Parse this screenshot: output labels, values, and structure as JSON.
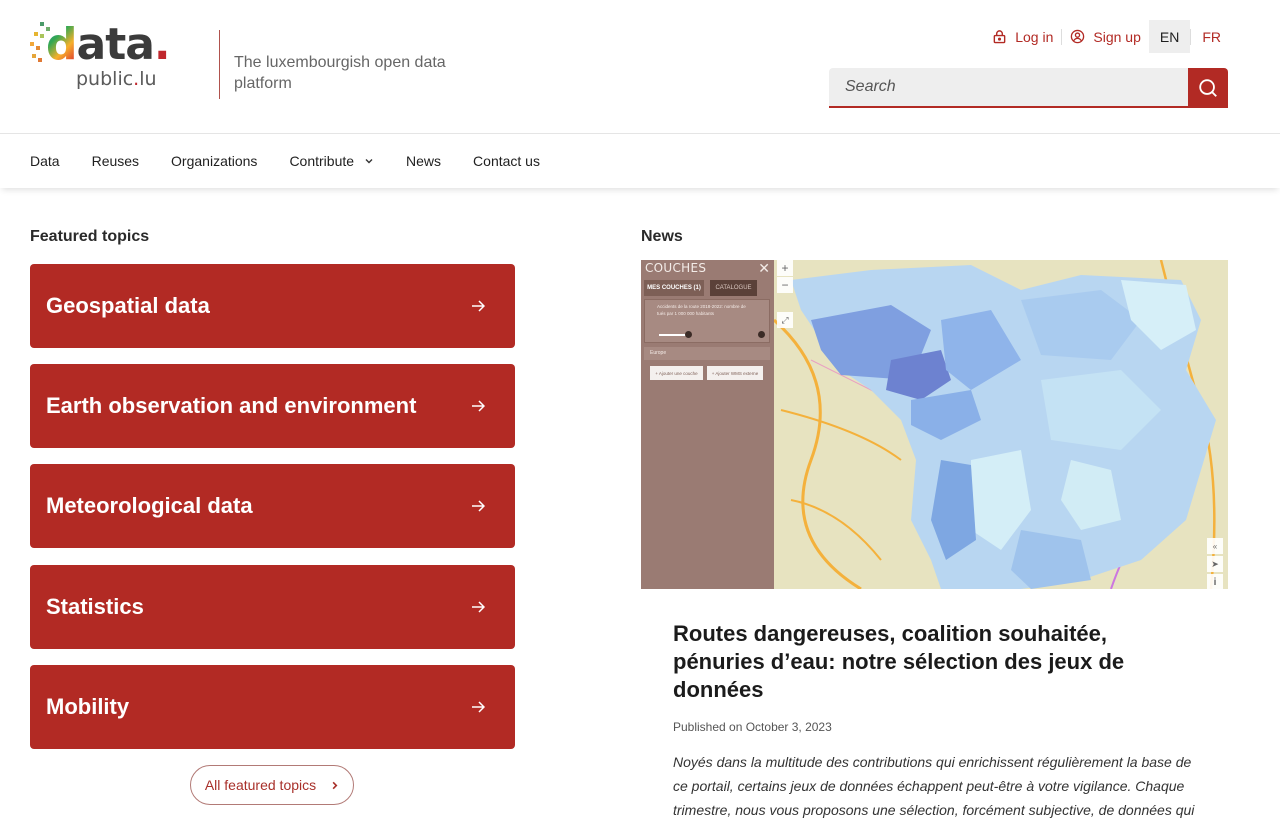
{
  "header": {
    "logo": {
      "word": "data",
      "dot": ".",
      "sub_name": "public",
      "sub_dot": ".",
      "sub_tld": "lu"
    },
    "tagline": "The luxembourgish open data platform",
    "login_label": "Log in",
    "signup_label": "Sign up",
    "languages": [
      {
        "code": "EN",
        "active": true
      },
      {
        "code": "FR",
        "active": false
      }
    ],
    "search": {
      "placeholder": "Search",
      "value": ""
    }
  },
  "nav": {
    "items": [
      {
        "label": "Data"
      },
      {
        "label": "Reuses"
      },
      {
        "label": "Organizations"
      },
      {
        "label": "Contribute",
        "has_dropdown": true
      },
      {
        "label": "News"
      },
      {
        "label": "Contact us"
      }
    ]
  },
  "featured": {
    "title": "Featured topics",
    "topics": [
      {
        "label": "Geospatial data"
      },
      {
        "label": "Earth observation and environment"
      },
      {
        "label": "Meteorological data"
      },
      {
        "label": "Statistics"
      },
      {
        "label": "Mobility"
      }
    ],
    "all_label": "All featured topics"
  },
  "news": {
    "title": "News",
    "image": {
      "panel_title": "COUCHES",
      "tab_layers": "MES COUCHES (1)",
      "tab_catalog": "CATALOGUE",
      "layer_text": "Accidents de la route 2018-2022: nombre de tués par 1 000 000 habitants",
      "base_layer": "Europe",
      "add_layer": "+ Ajouter une couche",
      "add_wms": "+ Ajouter WMS externe",
      "zoom_in": "+",
      "zoom_out": "−"
    },
    "article": {
      "title": "Routes dangereuses, coalition souhaitée, pénuries d’eau: notre sélection des jeux de données",
      "date": "Published on October 3, 2023",
      "excerpt": "Noyés dans la multitude des contributions qui enrichissent régulièrement la base de ce portail, certains jeux de données échappent peut-être à votre vigilance. Chaque trimestre, nous vous proposons une sélection, forcément subjective, de données qui"
    }
  },
  "colors": {
    "brand_red": "#b22a24",
    "text_dark": "#1f1f1f",
    "search_bg": "#eeeeee"
  }
}
